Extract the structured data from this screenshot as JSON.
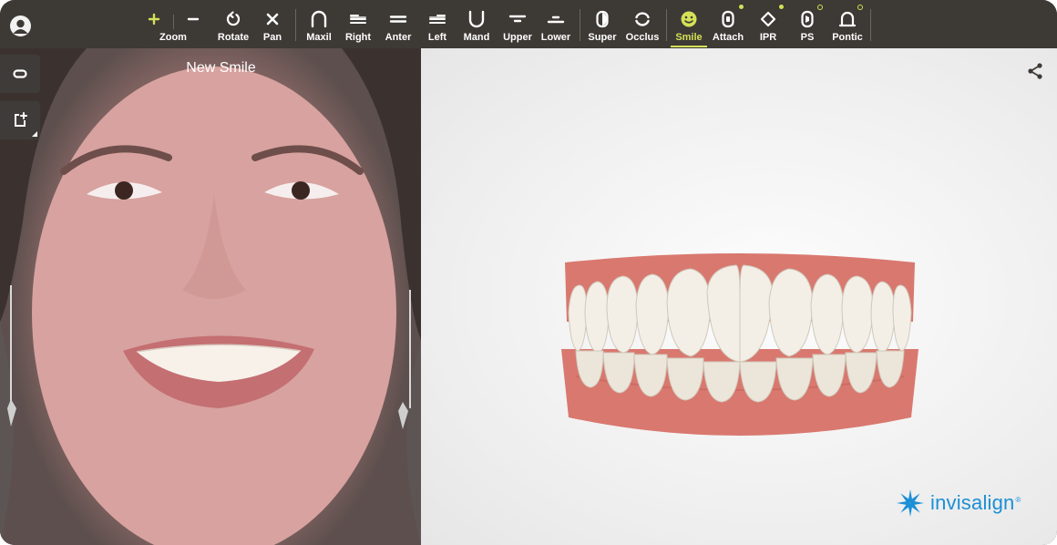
{
  "toolbar": {
    "tools": [
      {
        "name": "zoom-in",
        "label": "Zoom",
        "icon": "plus-icon"
      },
      {
        "name": "zoom-out",
        "label": "",
        "icon": "minus-icon"
      },
      {
        "name": "rotate",
        "label": "Rotate",
        "icon": "rotate-icon"
      },
      {
        "name": "pan",
        "label": "Pan",
        "icon": "pan-icon"
      },
      {
        "name": "maxillary",
        "label": "Maxil",
        "icon": "maxillary-arch-icon"
      },
      {
        "name": "right",
        "label": "Right",
        "icon": "right-view-icon"
      },
      {
        "name": "anterior",
        "label": "Anter",
        "icon": "anterior-view-icon"
      },
      {
        "name": "left",
        "label": "Left",
        "icon": "left-view-icon"
      },
      {
        "name": "mandibular",
        "label": "Mand",
        "icon": "mandibular-arch-icon"
      },
      {
        "name": "upper",
        "label": "Upper",
        "icon": "upper-jaw-icon"
      },
      {
        "name": "lower",
        "label": "Lower",
        "icon": "lower-jaw-icon"
      },
      {
        "name": "superimpose",
        "label": "Super",
        "icon": "superimpose-icon"
      },
      {
        "name": "occlusion",
        "label": "Occlus",
        "icon": "occlusion-icon"
      },
      {
        "name": "smile",
        "label": "Smile",
        "icon": "smile-face-icon"
      },
      {
        "name": "attachments",
        "label": "Attach",
        "icon": "attachment-icon"
      },
      {
        "name": "ipr",
        "label": "IPR",
        "icon": "ipr-icon"
      },
      {
        "name": "ps",
        "label": "PS",
        "icon": "precision-wing-icon"
      },
      {
        "name": "pontic",
        "label": "Pontic",
        "icon": "pontic-icon"
      }
    ]
  },
  "photo": {
    "title": "New Smile"
  },
  "brand": {
    "name": "invisalign",
    "reg": "®"
  },
  "colors": {
    "accent": "#d4e157",
    "toolbar_bg": "#3d3935",
    "brand_blue": "#1b8fd6",
    "gum": "#d9786f",
    "tooth": "#f3efe6"
  }
}
